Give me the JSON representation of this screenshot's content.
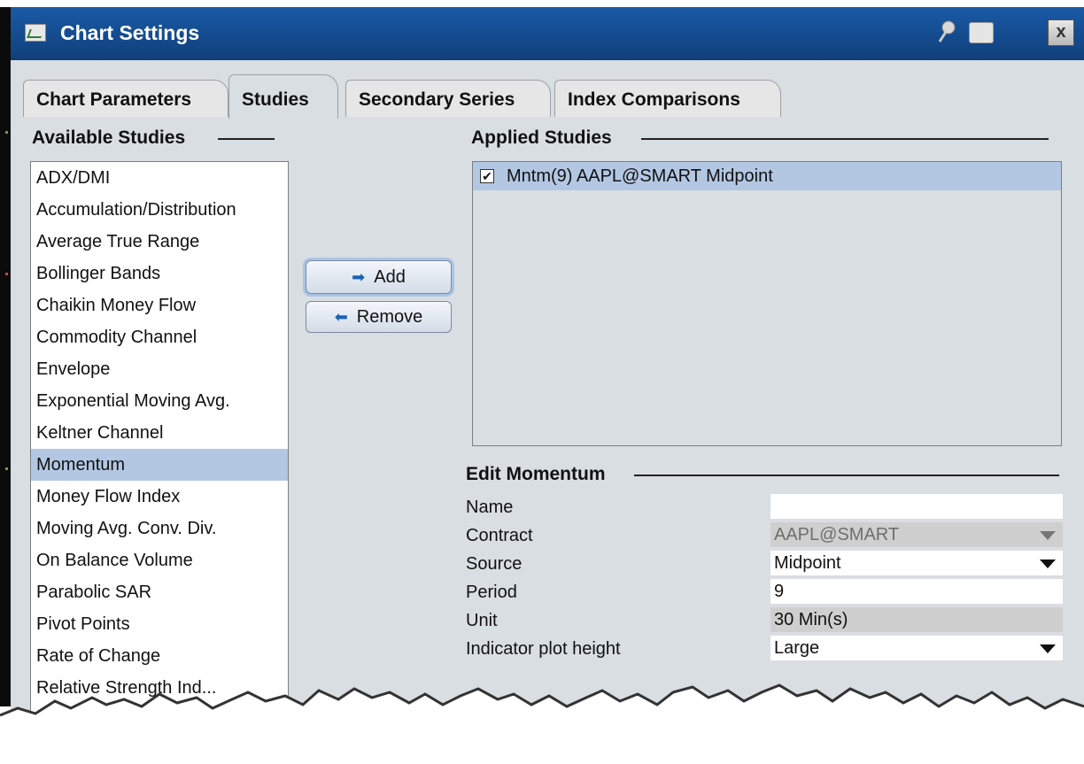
{
  "window": {
    "title": "Chart Settings",
    "icons": [
      "chart-icon",
      "pin-icon",
      "print-icon",
      "close-icon"
    ],
    "close_label": "x",
    "titlebar_color": "#1a4f94"
  },
  "tabs": [
    {
      "label": "Chart Parameters",
      "active": false
    },
    {
      "label": "Studies",
      "active": true
    },
    {
      "label": "Secondary Series",
      "active": false
    },
    {
      "label": "Index Comparisons",
      "active": false
    }
  ],
  "available": {
    "heading": "Available Studies",
    "items": [
      "ADX/DMI",
      "Accumulation/Distribution",
      "Average True Range",
      "Bollinger Bands",
      "Chaikin Money Flow",
      "Commodity Channel",
      "Envelope",
      "Exponential Moving Avg.",
      "Keltner Channel",
      "Momentum",
      "Money Flow Index",
      "Moving Avg. Conv. Div.",
      "On Balance Volume",
      "Parabolic SAR",
      "Pivot Points",
      "Rate of Change",
      "Relative Strength Ind..."
    ],
    "selected": "Momentum"
  },
  "buttons": {
    "add_label": "Add",
    "remove_label": "Remove"
  },
  "applied": {
    "heading": "Applied Studies",
    "items": [
      {
        "label": "Mntm(9) AAPL@SMART Midpoint",
        "checked": true
      }
    ]
  },
  "edit": {
    "heading": "Edit Momentum",
    "fields": {
      "name": {
        "label": "Name",
        "value": ""
      },
      "contract": {
        "label": "Contract",
        "value": "AAPL@SMART"
      },
      "source": {
        "label": "Source",
        "value": "Midpoint"
      },
      "period": {
        "label": "Period",
        "value": "9"
      },
      "unit": {
        "label": "Unit",
        "value": "30 Min(s)"
      },
      "plot_height": {
        "label": "Indicator plot height",
        "value": "Large"
      }
    }
  },
  "colors": {
    "selection": "#b3c7e3",
    "panel": "#d9dee3"
  }
}
